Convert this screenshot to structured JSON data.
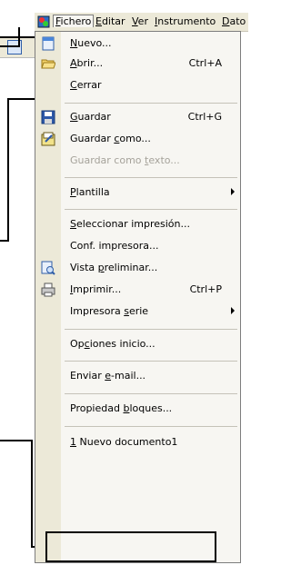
{
  "menubar": {
    "items": [
      "Fichero",
      "Editar",
      "Ver",
      "Instrumento",
      "Dato"
    ],
    "mnemonics": [
      "F",
      "E",
      "V",
      "I",
      "D"
    ]
  },
  "menu": {
    "items": [
      {
        "label_pre": "",
        "label_u": "N",
        "label_post": "uevo...",
        "shortcut": ""
      },
      {
        "label_pre": "",
        "label_u": "A",
        "label_post": "brir...",
        "shortcut": "Ctrl+A"
      },
      {
        "label_pre": "",
        "label_u": "C",
        "label_post": "errar",
        "shortcut": ""
      },
      {
        "label_pre": "",
        "label_u": "G",
        "label_post": "uardar",
        "shortcut": "Ctrl+G"
      },
      {
        "label_pre": "Guardar ",
        "label_u": "c",
        "label_post": "omo...",
        "shortcut": ""
      },
      {
        "label_pre": "Guardar como ",
        "label_u": "t",
        "label_post": "exto...",
        "shortcut": ""
      },
      {
        "label_pre": "",
        "label_u": "P",
        "label_post": "lantilla",
        "shortcut": ""
      },
      {
        "label_pre": "",
        "label_u": "S",
        "label_post": "eleccionar impresión...",
        "shortcut": ""
      },
      {
        "label_pre": "Conf. impresora...",
        "label_u": "",
        "label_post": "",
        "shortcut": ""
      },
      {
        "label_pre": "Vista ",
        "label_u": "p",
        "label_post": "reliminar...",
        "shortcut": ""
      },
      {
        "label_pre": "",
        "label_u": "I",
        "label_post": "mprimir...",
        "shortcut": "Ctrl+P"
      },
      {
        "label_pre": "Impresora ",
        "label_u": "s",
        "label_post": "erie",
        "shortcut": ""
      },
      {
        "label_pre": "Op",
        "label_u": "c",
        "label_post": "iones inicio...",
        "shortcut": ""
      },
      {
        "label_pre": "Enviar ",
        "label_u": "e",
        "label_post": "-mail...",
        "shortcut": ""
      },
      {
        "label_pre": "Propiedad ",
        "label_u": "b",
        "label_post": "loques...",
        "shortcut": ""
      },
      {
        "label_pre": "",
        "label_u": "1",
        "label_post": " Nuevo documento1",
        "shortcut": ""
      }
    ]
  },
  "colors": {
    "menu_bg": "#f7f6f2",
    "gutter_bg": "#ece9d8",
    "disabled_text": "#a5a29a",
    "border": "#7d7d7d"
  }
}
